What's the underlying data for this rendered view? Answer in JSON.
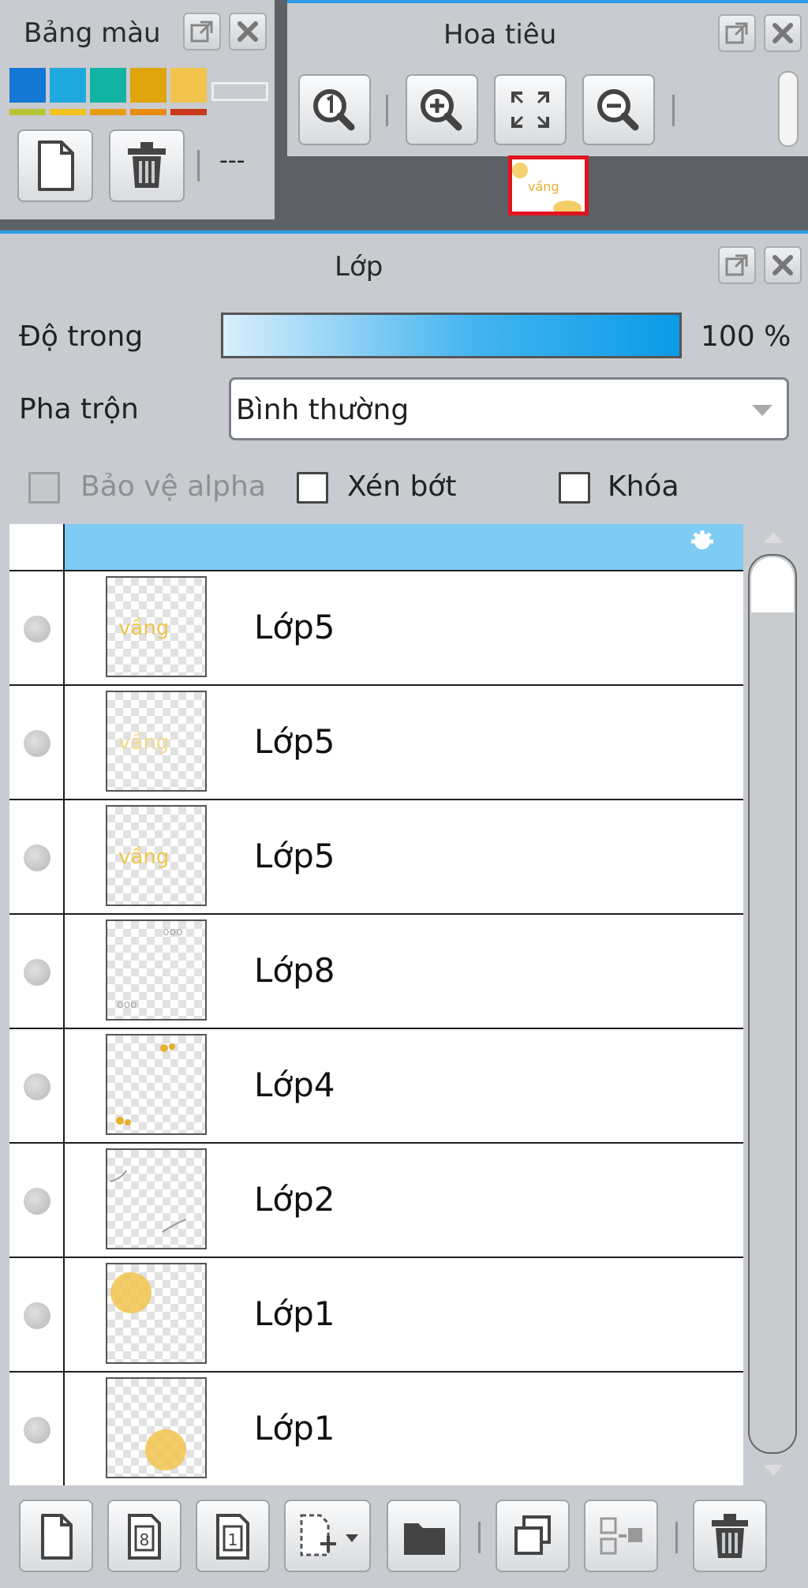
{
  "color_palette": {
    "title": "Bảng màu",
    "swatches": [
      "#1278d4",
      "#1fa9df",
      "#13b3a4",
      "#e0a40c",
      "#f2c44e"
    ],
    "stripes": [
      "#b8c436",
      "#f0c21e",
      "#e79d0f",
      "#ea8a0e",
      "#c9381a"
    ],
    "more_label": "---"
  },
  "navigator": {
    "title": "Hoa tiêu"
  },
  "layer_panel": {
    "title": "Lớp",
    "opacity_label": "Độ trong",
    "opacity_value": "100 %",
    "opacity_fraction": 1.0,
    "blend_label": "Pha trộn",
    "blend_value": "Bình thường",
    "protect_alpha_label": "Bảo vệ alpha",
    "clipping_label": "Xén bớt",
    "lock_label": "Khóa",
    "selected_row_color": "#7ecbf4",
    "layers": [
      {
        "name": "Lớp5",
        "thumb": "text"
      },
      {
        "name": "Lớp5",
        "thumb": "text-faint"
      },
      {
        "name": "Lớp5",
        "thumb": "text"
      },
      {
        "name": "Lớp8",
        "thumb": "sketch"
      },
      {
        "name": "Lớp4",
        "thumb": "dots"
      },
      {
        "name": "Lớp2",
        "thumb": "lines"
      },
      {
        "name": "Lớp1",
        "thumb": "blob-top"
      },
      {
        "name": "Lớp1",
        "thumb": "blob-bottom"
      }
    ],
    "bottom_toolbar_icons": [
      "new-layer-icon",
      "new-8bit-layer-icon",
      "new-1bit-layer-icon",
      "add-layer-menu-icon",
      "folder-icon",
      "duplicate-layer-icon",
      "merge-down-icon",
      "delete-layer-icon"
    ]
  }
}
